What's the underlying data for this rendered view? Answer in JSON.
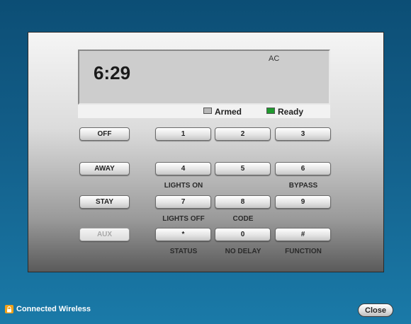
{
  "display": {
    "time": "6:29",
    "indicator": "AC"
  },
  "status": {
    "armed_label": "Armed",
    "ready_label": "Ready",
    "armed_led_color": "#b8b8b8",
    "ready_led_color": "#1f9a2e"
  },
  "side_buttons": {
    "off": "OFF",
    "away": "AWAY",
    "stay": "STAY",
    "aux": "AUX"
  },
  "keys": {
    "k1": "1",
    "k2": "2",
    "k3": "3",
    "k4": "4",
    "k5": "5",
    "k6": "6",
    "k7": "7",
    "k8": "8",
    "k9": "9",
    "kstar": "*",
    "k0": "0",
    "khash": "#"
  },
  "key_labels": {
    "lights_on": "LIGHTS ON",
    "bypass": "BYPASS",
    "lights_off": "LIGHTS OFF",
    "code": "CODE",
    "status": "STATUS",
    "no_delay": "NO DELAY",
    "function": "FUNCTION"
  },
  "footer": {
    "connection": "Connected Wireless",
    "close_label": "Close",
    "connection_icon": "lock-icon"
  }
}
